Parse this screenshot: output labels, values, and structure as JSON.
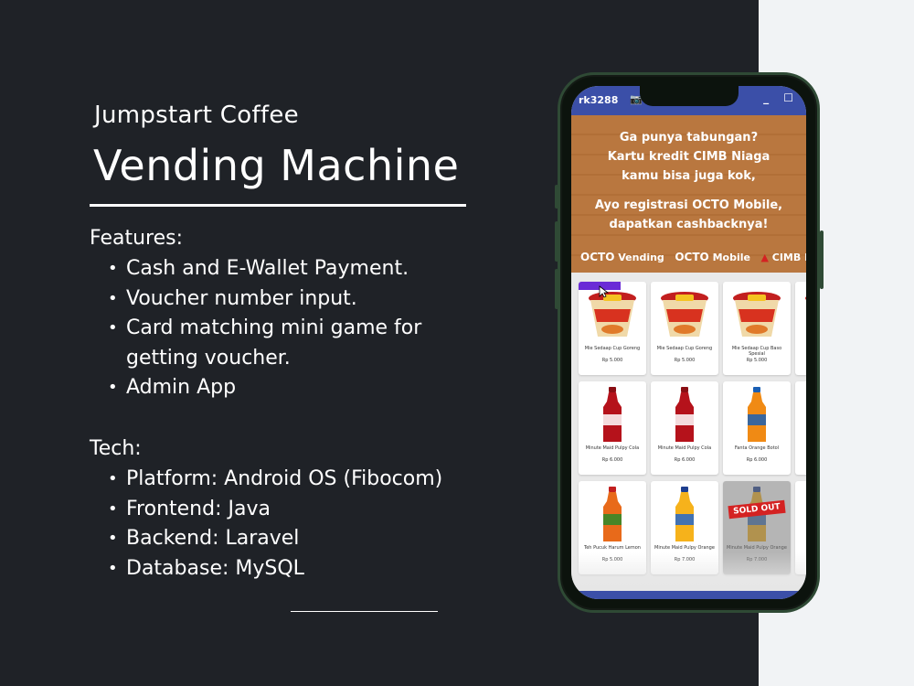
{
  "subtitle": "Jumpstart Coffee",
  "title": "Vending Machine",
  "features": {
    "label": "Features:",
    "items": [
      "Cash and E-Wallet Payment.",
      "Voucher number input.",
      "Card matching mini game for",
      "getting voucher.",
      "Admin App"
    ]
  },
  "tech": {
    "label": "Tech:",
    "items": [
      "Platform: Android OS (Fibocom)",
      "Frontend: Java",
      "Backend: Laravel",
      "Database: MySQL"
    ]
  },
  "phone": {
    "statusbar": {
      "account": "rk3288",
      "camera_icon": "camera-icon",
      "controls": "_ ☐"
    },
    "banner": {
      "line1": "Ga punya tabungan?",
      "line2": "Kartu kredit CIMB Niaga",
      "line3": "kamu bisa juga kok,",
      "line4": "Ayo registrasi OCTO Mobile,",
      "line5": "dapatkan cashbacknya!",
      "logo1": "OCTO",
      "logo1_sub": "Vending",
      "logo2": "OCTO",
      "logo2_sub": "Mobile",
      "logo3": "CIMB NIAGA"
    },
    "products": [
      {
        "name": "Mie Sedaap Cup Goreng",
        "price": "Rp 5.000",
        "kind": "cup"
      },
      {
        "name": "Mie Sedaap Cup Goreng",
        "price": "Rp 5.000",
        "kind": "cup"
      },
      {
        "name": "Mie Sedaap Cup Baso Spesial",
        "price": "Rp 5.000",
        "kind": "cup"
      },
      {
        "name": "Mie Se",
        "price": "",
        "kind": "cup"
      },
      {
        "name": "Minute Maid Pulpy Cola",
        "price": "Rp 6.000",
        "kind": "cola"
      },
      {
        "name": "Minute Maid Pulpy Cola",
        "price": "Rp 6.000",
        "kind": "cola"
      },
      {
        "name": "Fanta Orange Botol",
        "price": "Rp 6.000",
        "kind": "fanta"
      },
      {
        "name": "",
        "price": "",
        "kind": "blank"
      },
      {
        "name": "Teh Pucuk Harum Lemon",
        "price": "Rp 5.000",
        "kind": "tea"
      },
      {
        "name": "Minute Maid Pulpy Orange",
        "price": "Rp 7.000",
        "kind": "juice"
      },
      {
        "name": "Minute Maid Pulpy Orange",
        "price": "Rp 7.000",
        "kind": "juice",
        "sold_out": "SOLD OUT"
      },
      {
        "name": "",
        "price": "",
        "kind": "blank"
      }
    ],
    "colors": {
      "statusbar": "#3b4fa8",
      "banner": "#b9773f",
      "sold_out": "#d42222",
      "frame": "#2f4a35"
    }
  }
}
